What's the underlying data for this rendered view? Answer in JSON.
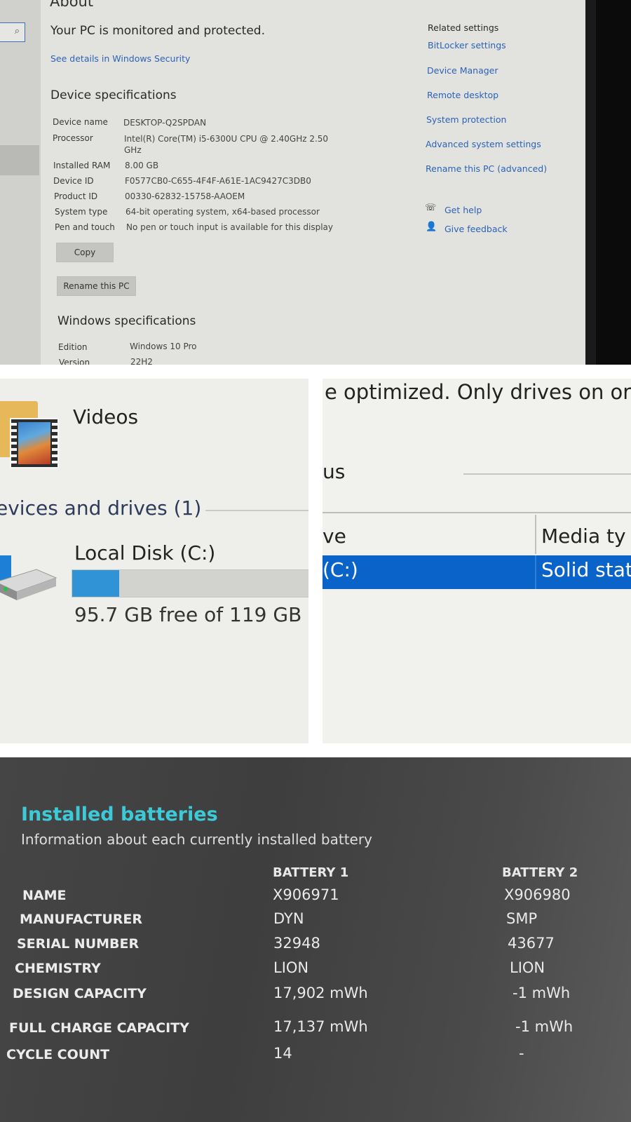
{
  "about": {
    "heading": "About",
    "search_icon": "search-icon",
    "protected_text": "Your PC is monitored and protected.",
    "security_link": "See details in Windows Security",
    "device_specs_heading": "Device specifications",
    "specs": [
      {
        "label": "Device name",
        "value": "DESKTOP-Q2SPDAN"
      },
      {
        "label": "Processor",
        "value": "Intel(R) Core(TM) i5-6300U CPU @ 2.40GHz   2.50",
        "value2": "GHz"
      },
      {
        "label": "Installed RAM",
        "value": "8.00 GB"
      },
      {
        "label": "Device ID",
        "value": "F0577CB0-C655-4F4F-A61E-1AC9427C3DB0"
      },
      {
        "label": "Product ID",
        "value": "00330-62832-15758-AAOEM"
      },
      {
        "label": "System type",
        "value": "64-bit operating system, x64-based processor"
      },
      {
        "label": "Pen and touch",
        "value": "No pen or touch input is available for this display"
      }
    ],
    "copy_button": "Copy",
    "rename_button": "Rename this PC",
    "windows_specs_heading": "Windows specifications",
    "win_specs": [
      {
        "label": "Edition",
        "value": "Windows 10 Pro"
      },
      {
        "label": "Version",
        "value": "22H2"
      }
    ],
    "related_heading": "Related settings",
    "related_links": [
      "BitLocker settings",
      "Device Manager",
      "Remote desktop",
      "System protection",
      "Advanced system settings",
      "Rename this PC (advanced)"
    ],
    "get_help": "Get help",
    "give_feedback": "Give feedback"
  },
  "explorer": {
    "folder_label": "Videos",
    "section_heading": "evices and drives (1)",
    "drive_name": "Local Disk (C:)",
    "drive_used_fraction": 0.196,
    "drive_free_text": "95.7 GB free of 119 GB",
    "accent_color": "#2f93d6"
  },
  "optimize": {
    "top_text": "e optimized. Only drives on or",
    "status_fragment": "us",
    "col_drive_fragment": "ve",
    "col_media_fragment": "Media ty",
    "selected_drive_fragment": "(C:)",
    "selected_media_fragment": "Solid stat",
    "selection_color": "#0a63c9"
  },
  "batteries": {
    "title": "Installed batteries",
    "subtitle": "Information about each currently installed battery",
    "columns": [
      "BATTERY 1",
      "BATTERY 2"
    ],
    "rows": [
      {
        "label": "NAME",
        "b1": "X906971",
        "b2": "X906980"
      },
      {
        "label": "MANUFACTURER",
        "b1": "DYN",
        "b2": "SMP"
      },
      {
        "label": "SERIAL NUMBER",
        "b1": "32948",
        "b2": "43677"
      },
      {
        "label": "CHEMISTRY",
        "b1": "LION",
        "b2": "LION"
      },
      {
        "label": "DESIGN CAPACITY",
        "b1": "17,902 mWh",
        "b2": "-1 mWh"
      },
      {
        "label": "FULL CHARGE CAPACITY",
        "b1": "17,137 mWh",
        "b2": "-1 mWh"
      },
      {
        "label": "CYCLE COUNT",
        "b1": "14",
        "b2": "-"
      }
    ],
    "title_color": "#3ec9d8"
  }
}
